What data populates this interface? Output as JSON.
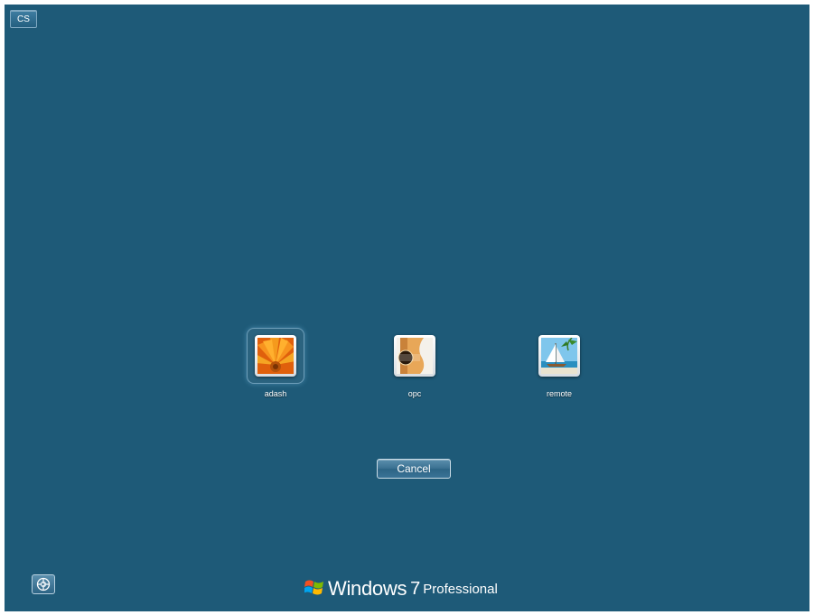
{
  "language_indicator": {
    "label": "CS"
  },
  "users": [
    {
      "name": "adash",
      "picture": "orange-flower-icon",
      "selected": true
    },
    {
      "name": "opc",
      "picture": "guitar-icon",
      "selected": false
    },
    {
      "name": "remote",
      "picture": "sailboat-icon",
      "selected": false
    }
  ],
  "cancel_button": {
    "label": "Cancel"
  },
  "ease_of_access": {
    "icon": "ease-of-access-icon"
  },
  "branding": {
    "windows": "Windows",
    "version": "7",
    "edition": "Professional",
    "logo_icon": "windows-logo-icon"
  },
  "colors": {
    "background": "#1e5a78",
    "text": "#ffffff"
  }
}
